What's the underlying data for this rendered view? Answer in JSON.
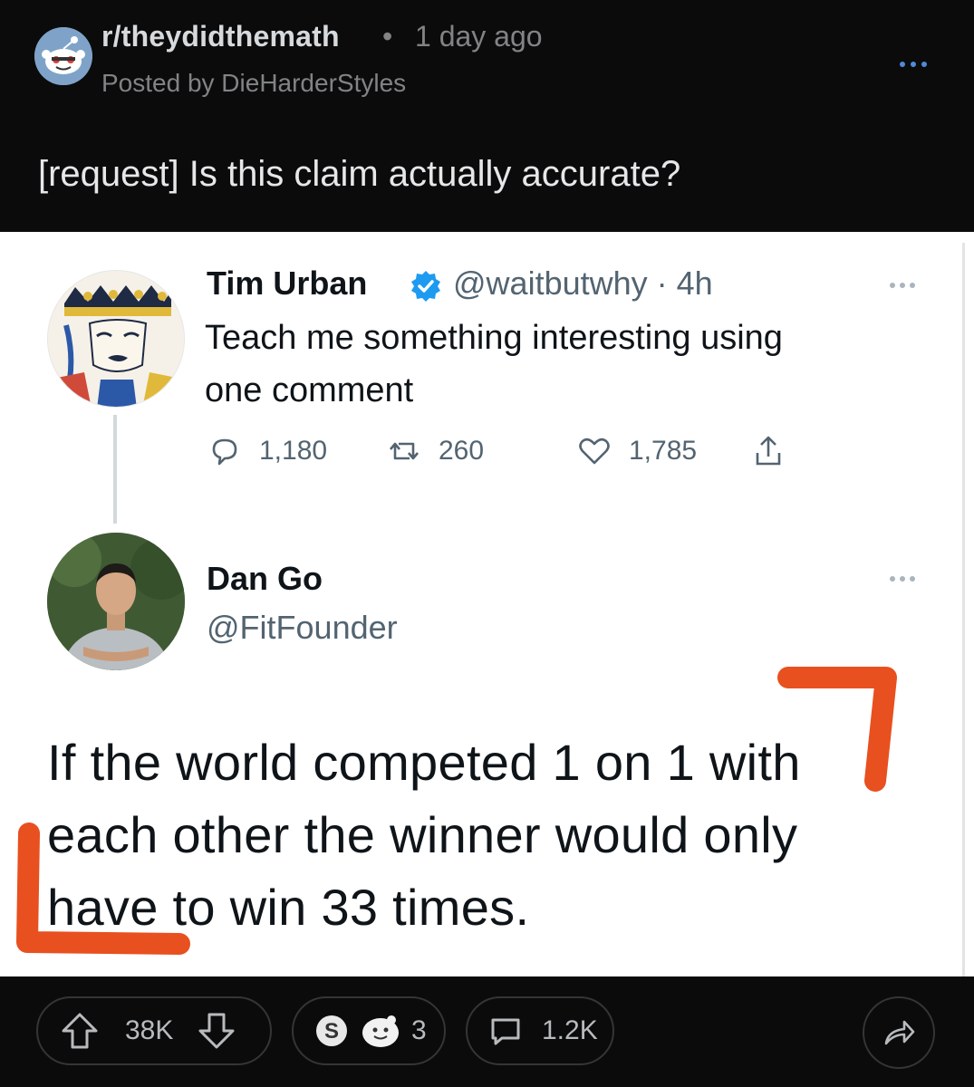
{
  "post": {
    "subreddit": "r/theydidthemath",
    "separator": "•",
    "age": "1 day ago",
    "posted_by": "Posted by DieHarderStyles",
    "title": "[request] Is this claim actually accurate?"
  },
  "tweet": {
    "author_name": "Tim Urban",
    "author_handle_time": "@waitbutwhy · 4h",
    "text_line1": "Teach me something interesting using",
    "text_line2": "one comment",
    "replies": "1,180",
    "retweets": "260",
    "likes": "1,785"
  },
  "reply": {
    "author_name": "Dan Go",
    "author_handle": "@FitFounder",
    "line1": "If the world competed 1 on 1 with",
    "line2": "each other the winner would only",
    "line3": "have to win 33 times."
  },
  "annotation_color": "#e8501f",
  "bar": {
    "upvotes": "38K",
    "award_count": "3",
    "comments": "1.2K"
  }
}
